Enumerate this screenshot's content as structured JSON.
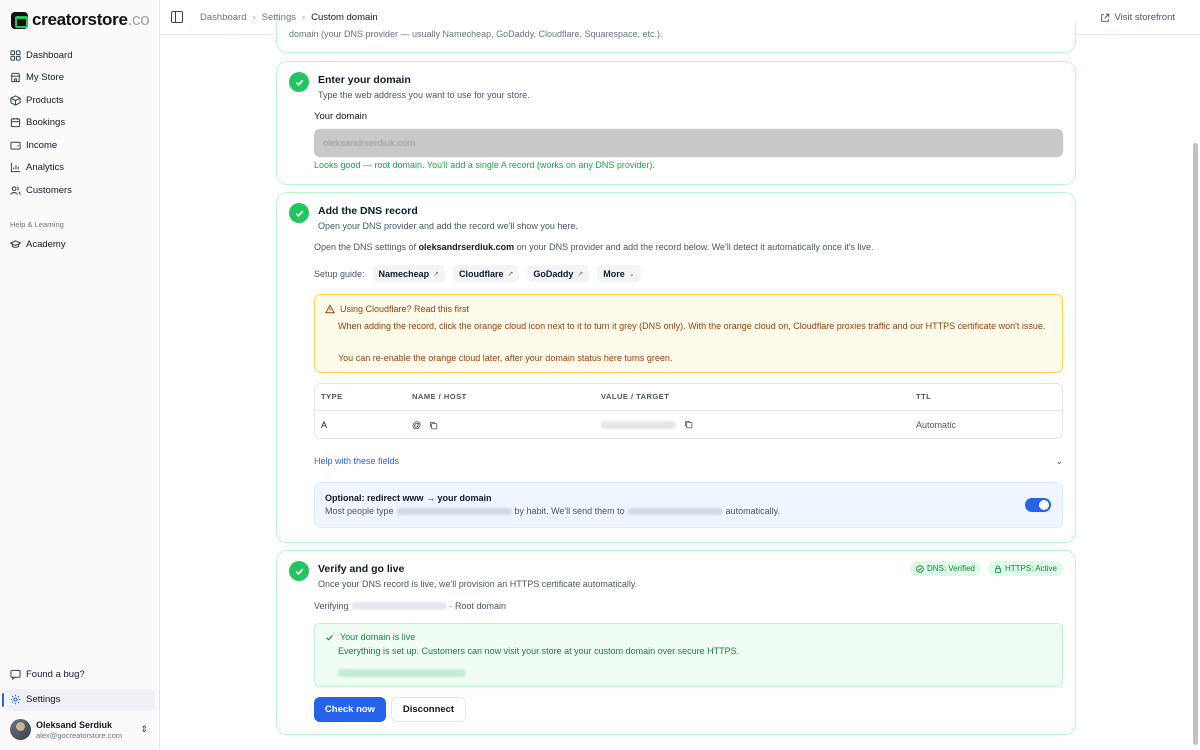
{
  "brand": {
    "name": "creatorstore",
    "tld": ".co"
  },
  "sidebar": {
    "items": [
      {
        "label": "Dashboard",
        "icon": "dashboard-icon"
      },
      {
        "label": "My Store",
        "icon": "store-icon"
      },
      {
        "label": "Products",
        "icon": "box-icon"
      },
      {
        "label": "Bookings",
        "icon": "calendar-icon"
      },
      {
        "label": "Income",
        "icon": "wallet-icon"
      },
      {
        "label": "Analytics",
        "icon": "chart-icon"
      },
      {
        "label": "Customers",
        "icon": "users-icon"
      }
    ],
    "section_label": "Help & Learning",
    "learning": [
      {
        "label": "Academy",
        "icon": "graduation-cap-icon"
      }
    ],
    "bottom": [
      {
        "label": "Found a bug?",
        "icon": "message-icon"
      },
      {
        "label": "Settings",
        "icon": "gear-icon",
        "active": true
      }
    ],
    "user": {
      "name": "Oleksand Serdiuk",
      "email": "alex@gocreatorstore.com"
    }
  },
  "header": {
    "breadcrumb": [
      "Dashboard",
      "Settings",
      "Custom domain"
    ],
    "visit_label": "Visit storefront"
  },
  "top_fragment": "domain (your DNS provider — usually Namecheap, GoDaddy, Cloudflare, Squarespace, etc.).",
  "step1": {
    "title": "Enter your domain",
    "subtitle": "Type the web address you want to use for your store.",
    "field_label": "Your domain",
    "field_value": "oleksandrserdiuk.com",
    "hint": "Looks good — root domain. You'll add a single A record (works on any DNS provider)."
  },
  "step2": {
    "title": "Add the DNS record",
    "subtitle": "Open your DNS provider and add the record we'll show you here.",
    "intro_prefix": "Open the DNS settings of ",
    "intro_domain": "oleksandrserdiuk.com",
    "intro_suffix": " on your DNS provider and add the record below. We'll detect it automatically once it's live.",
    "guide_label": "Setup guide:",
    "guides": [
      "Namecheap",
      "Cloudflare",
      "GoDaddy"
    ],
    "guide_more": "More",
    "warning": {
      "title": "Using Cloudflare? Read this first",
      "body": "When adding the record, click the orange cloud icon next to it to turn it grey (DNS only). With the orange cloud on, Cloudflare proxies traffic and our HTTPS certificate won't issue.",
      "body2": "You can re-enable the orange cloud later, after your domain status here turns green."
    },
    "table": {
      "headers": [
        "TYPE",
        "NAME / HOST",
        "VALUE / TARGET",
        "TTL"
      ],
      "row": {
        "type": "A",
        "name": "@",
        "ttl": "Automatic"
      }
    },
    "help_link": "Help with these fields",
    "redirect": {
      "title": "Optional: redirect www → your domain",
      "sub_prefix": "Most people type",
      "sub_middle": "by habit. We'll send them to",
      "sub_suffix": "automatically.",
      "enabled": true
    }
  },
  "step3": {
    "title": "Verify and go live",
    "subtitle": "Once your DNS record is live, we'll provision an HTTPS certificate automatically.",
    "badges": [
      "DNS: Verified",
      "HTTPS: Active"
    ],
    "verifying_prefix": "Verifying",
    "verifying_suffix": "· Root domain",
    "live_title": "Your domain is live",
    "live_body": "Everything is set up. Customers can now visit your store at your custom domain over secure HTTPS.",
    "check_button": "Check now",
    "disconnect_button": "Disconnect"
  },
  "colors": {
    "accent": "#2563eb",
    "success": "#22c55e",
    "warning_bg": "#fffbeb"
  }
}
